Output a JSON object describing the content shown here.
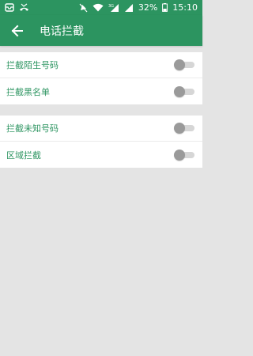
{
  "status_bar": {
    "left_icons": [
      "notification-icon",
      "missed-call-icon"
    ],
    "right_icons": [
      "silent-icon",
      "wifi-icon",
      "signal-3g-icon",
      "signal-icon"
    ],
    "battery": "32%",
    "time": "15:10"
  },
  "app_bar": {
    "title": "电话拦截",
    "back_icon": "arrow-left-icon"
  },
  "groups": [
    {
      "items": [
        {
          "label": "拦截陌生号码",
          "enabled": false
        },
        {
          "label": "拦截黑名单",
          "enabled": false
        }
      ]
    },
    {
      "items": [
        {
          "label": "拦截未知号码",
          "enabled": false
        },
        {
          "label": "区域拦截",
          "enabled": false
        }
      ]
    }
  ],
  "colors": {
    "primary": "#2c9460",
    "background": "#e4e4e4",
    "toggle_off_thumb": "#9a9a9a",
    "toggle_off_track": "#d6d6d6"
  }
}
